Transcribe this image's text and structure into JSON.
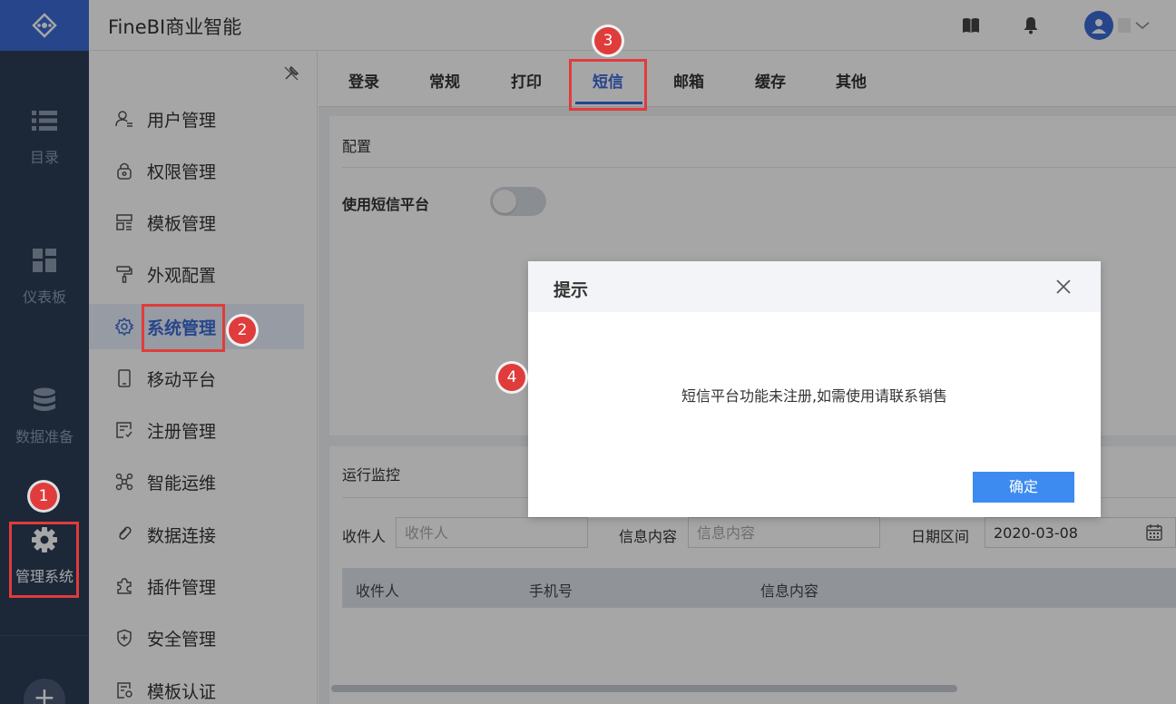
{
  "app": {
    "title": "FineBI商业智能"
  },
  "rail": {
    "items": [
      {
        "label": "目录",
        "icon": "list-icon"
      },
      {
        "label": "仪表板",
        "icon": "dashboard-icon"
      },
      {
        "label": "数据准备",
        "icon": "database-icon"
      },
      {
        "label": "管理系统",
        "icon": "gear-icon"
      }
    ],
    "add_label": "+"
  },
  "header": {
    "icons": [
      "book-icon",
      "bell-icon",
      "user-avatar-icon",
      "chevron-down-icon"
    ]
  },
  "submenu": {
    "items": [
      {
        "label": "用户管理",
        "icon": "user-icon"
      },
      {
        "label": "权限管理",
        "icon": "lock-icon"
      },
      {
        "label": "模板管理",
        "icon": "template-icon"
      },
      {
        "label": "外观配置",
        "icon": "paint-roller-icon"
      },
      {
        "label": "系统管理",
        "icon": "gear-icon"
      },
      {
        "label": "移动平台",
        "icon": "mobile-icon"
      },
      {
        "label": "注册管理",
        "icon": "register-icon"
      },
      {
        "label": "智能运维",
        "icon": "network-icon"
      },
      {
        "label": "数据连接",
        "icon": "link-icon"
      },
      {
        "label": "插件管理",
        "icon": "plugin-icon"
      },
      {
        "label": "安全管理",
        "icon": "shield-icon"
      },
      {
        "label": "模板认证",
        "icon": "certificate-icon"
      }
    ],
    "active_index": 4
  },
  "tabs": {
    "items": [
      "登录",
      "常规",
      "打印",
      "短信",
      "邮箱",
      "缓存",
      "其他"
    ],
    "active_index": 3
  },
  "config": {
    "title": "配置",
    "use_sms_label": "使用短信平台",
    "use_sms_enabled": false
  },
  "monitor": {
    "title": "运行监控",
    "receiver_label": "收件人",
    "receiver_placeholder": "收件人",
    "content_label": "信息内容",
    "content_placeholder": "信息内容",
    "date_label": "日期区间",
    "date_value": "2020-03-08",
    "columns": [
      "收件人",
      "手机号",
      "信息内容"
    ]
  },
  "dialog": {
    "title": "提示",
    "message": "短信平台功能未注册,如需使用请联系销售",
    "ok_label": "确定"
  },
  "annotations": [
    "1",
    "2",
    "3",
    "4"
  ],
  "colors": {
    "accent": "#3d6ad6",
    "rail_bg": "#2b3c57",
    "highlight": "#e03c3c",
    "ok_button": "#3d8bf0"
  }
}
